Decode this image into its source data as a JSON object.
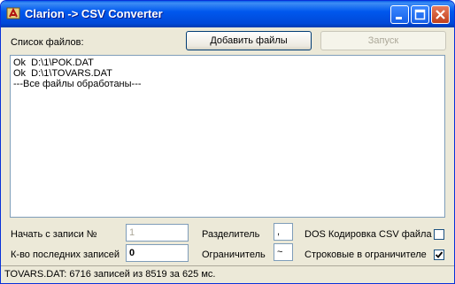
{
  "window": {
    "title": "Clarion -> CSV Converter"
  },
  "files": {
    "label": "Список файлов:",
    "add_button": "Добавить файлы",
    "start_button": "Запуск",
    "lines": [
      "Ok  D:\\1\\POK.DAT",
      "Ok  D:\\1\\TOVARS.DAT",
      "---Все файлы обработаны---"
    ]
  },
  "options": {
    "start_record_label": "Начать с записи №",
    "start_record_value": "1",
    "last_records_label": "К-во последних записей",
    "last_records_value": "0",
    "separator_label": "Разделитель",
    "separator_value": ",",
    "delimiter_label": "Ограничитель",
    "delimiter_value": "~",
    "dos_encoding_label": "DOS Кодировка CSV файла",
    "dos_encoding_checked": false,
    "string_delimiter_label": "Строковые в ограничителе",
    "string_delimiter_checked": true
  },
  "status": {
    "text": "TOVARS.DAT:  6716 записей из 8519 за 625 мс."
  },
  "colors": {
    "titlebar": "#0058ee",
    "window_bg": "#ece9d8",
    "close_button": "#c2401c"
  }
}
